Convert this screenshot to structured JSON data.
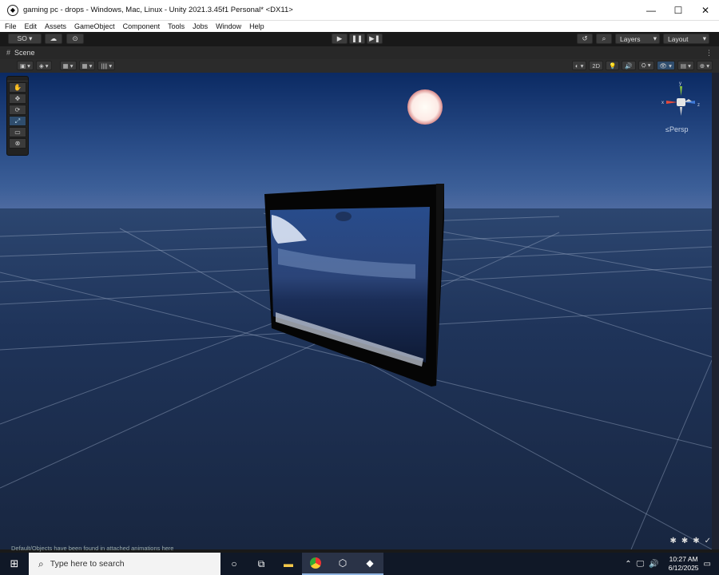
{
  "window": {
    "title": "gaming pc - drops - Windows, Mac, Linux - Unity 2021.3.45f1 Personal* <DX11>",
    "minimize": "—",
    "maximize": "☐",
    "close": "✕"
  },
  "menu": [
    "File",
    "Edit",
    "Assets",
    "GameObject",
    "Component",
    "Tools",
    "Jobs",
    "Window",
    "Help"
  ],
  "toolbar": {
    "account": "SO ▾",
    "cloud_icon": "☁",
    "collab_icon": "⊙",
    "play": "▶",
    "pause": "❚❚",
    "step": "▶❚",
    "history": "↺",
    "search": "⌕",
    "layers": "Layers",
    "layout": "Layout"
  },
  "scene_tab": {
    "label": "Scene",
    "icon": "#",
    "menu": "⋮"
  },
  "scene_toolbar": {
    "left": [
      "▣ ▾",
      "◈ ▾",
      "▦ ▾",
      "▦ ▾",
      "|||| ▾"
    ],
    "right": [
      "◐ ▾",
      "2D",
      "💡",
      "🔊",
      "⛭ ▾",
      "👁 ▾",
      "▤ ▾",
      "⊕ ▾"
    ]
  },
  "palette": [
    "✋",
    "✥",
    "⟳",
    "⤢",
    "▭",
    "⊗"
  ],
  "gizmo": {
    "y": "y",
    "x": "x",
    "z": "z",
    "projection": "≤Persp"
  },
  "status": {
    "message": "Default/Objects have been found in attached animations here"
  },
  "taskbar": {
    "search_placeholder": "Type here to search",
    "time": "10:27 AM",
    "date": "6/12/2025"
  },
  "colors": {
    "sky_top": "#0b2a63",
    "sky_horizon": "#3c5f98",
    "ground": "#24385a",
    "accent": "#2f4d6d"
  }
}
